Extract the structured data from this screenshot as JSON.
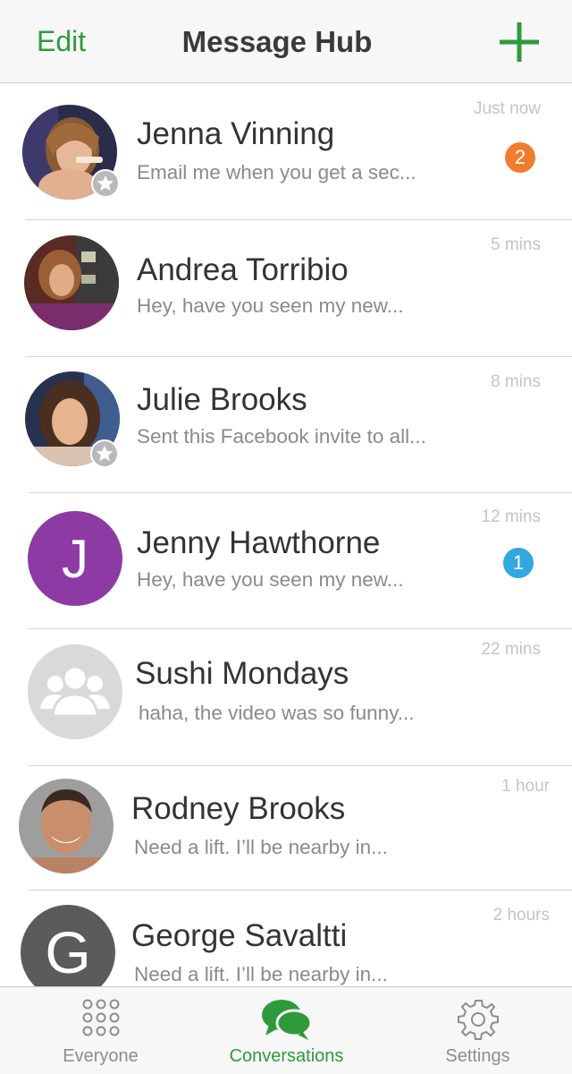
{
  "navbar": {
    "edit_label": "Edit",
    "title": "Message Hub",
    "add_icon": "plus-icon"
  },
  "colors": {
    "accent_green": "#2f9a3c",
    "badge_orange": "#f07d2e",
    "badge_blue": "#31a8e0",
    "avatar_purple": "#8e3aa5",
    "avatar_gray_dark": "#5b5b5b",
    "avatar_gray_light": "#d9d9d9"
  },
  "conversations": [
    {
      "name": "Jenna Vinning",
      "preview": "Email me when you get a sec...",
      "time": "Just now",
      "unread": "2",
      "favorite": true,
      "avatar": "photo"
    },
    {
      "name": "Andrea Torribio",
      "preview": "Hey, have you seen my new...",
      "time": "5 mins",
      "avatar": "photo"
    },
    {
      "name": "Julie Brooks",
      "preview": "Sent this Facebook invite to all...",
      "time": "8 mins",
      "favorite": true,
      "avatar": "photo"
    },
    {
      "name": "Jenny Hawthorne",
      "preview": "Hey, have you seen my new...",
      "time": "12 mins",
      "unread": "1",
      "avatar_letter": "J"
    },
    {
      "name": "Sushi Mondays",
      "preview": "haha, the video was so funny...",
      "time": "22 mins",
      "avatar": "group-icon"
    },
    {
      "name": "Rodney Brooks",
      "preview": "Need a lift. I’ll be nearby in...",
      "time": "1 hour",
      "avatar": "photo"
    },
    {
      "name": "George Savaltti",
      "preview": "Need a lift. I’ll be nearby in...",
      "time": "2 hours",
      "avatar_letter": "G"
    }
  ],
  "tabs": [
    {
      "label": "Everyone",
      "icon": "grid-dots-icon",
      "active": false
    },
    {
      "label": "Conversations",
      "icon": "chat-bubbles-icon",
      "active": true
    },
    {
      "label": "Settings",
      "icon": "gear-icon",
      "active": false
    }
  ]
}
